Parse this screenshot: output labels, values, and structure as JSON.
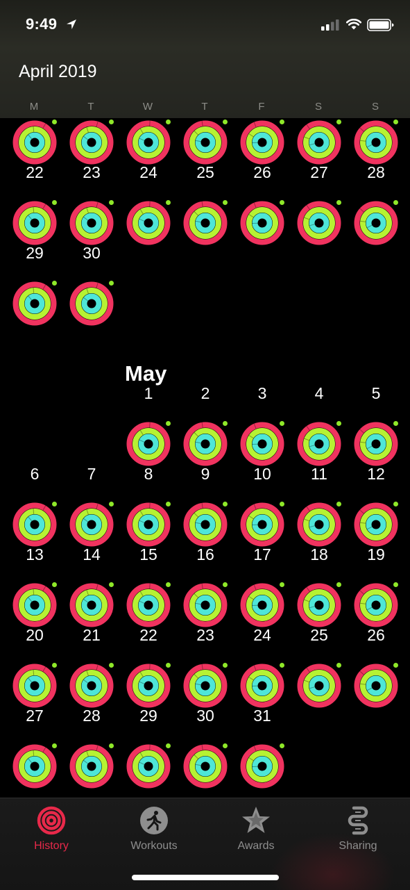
{
  "status_bar": {
    "time": "9:49",
    "icons": [
      "location-arrow-icon",
      "cellular-signal-icon",
      "wifi-icon",
      "battery-icon"
    ]
  },
  "header": {
    "month_title": "April 2019",
    "weekdays": [
      "M",
      "T",
      "W",
      "T",
      "F",
      "S",
      "S"
    ]
  },
  "calendar": {
    "april": {
      "rows": [
        {
          "days": [
            "",
            "",
            "",
            "",
            "",
            "",
            ""
          ],
          "rings": [
            true,
            true,
            true,
            true,
            true,
            true,
            true
          ]
        },
        {
          "days": [
            "22",
            "23",
            "24",
            "25",
            "26",
            "27",
            "28"
          ],
          "rings": [
            true,
            true,
            true,
            true,
            true,
            true,
            true
          ]
        },
        {
          "days": [
            "29",
            "30",
            "",
            "",
            "",
            "",
            ""
          ],
          "rings": [
            true,
            true,
            false,
            false,
            false,
            false,
            false
          ]
        }
      ]
    },
    "may": {
      "title": "May",
      "rows": [
        {
          "days": [
            "",
            "",
            "1",
            "2",
            "3",
            "4",
            "5"
          ],
          "rings": [
            false,
            false,
            true,
            true,
            true,
            true,
            true
          ]
        },
        {
          "days": [
            "6",
            "7",
            "8",
            "9",
            "10",
            "11",
            "12"
          ],
          "rings": [
            true,
            true,
            true,
            true,
            true,
            true,
            true
          ]
        },
        {
          "days": [
            "13",
            "14",
            "15",
            "16",
            "17",
            "18",
            "19"
          ],
          "rings": [
            true,
            true,
            true,
            true,
            true,
            true,
            true
          ]
        },
        {
          "days": [
            "20",
            "21",
            "22",
            "23",
            "24",
            "25",
            "26"
          ],
          "rings": [
            true,
            true,
            true,
            true,
            true,
            true,
            true
          ]
        },
        {
          "days": [
            "27",
            "28",
            "29",
            "30",
            "31",
            "",
            ""
          ],
          "rings": [
            true,
            true,
            true,
            true,
            true,
            false,
            false
          ]
        }
      ]
    },
    "ring_colors": {
      "move": "#f0335f",
      "exercise": "#b6f233",
      "stand": "#4ee6d8",
      "goal_dot": "#8fe829"
    }
  },
  "tabbar": {
    "tabs": [
      {
        "label": "History",
        "icon": "activity-rings-icon",
        "active": true
      },
      {
        "label": "Workouts",
        "icon": "running-figure-icon",
        "active": false
      },
      {
        "label": "Awards",
        "icon": "award-star-icon",
        "active": false
      },
      {
        "label": "Sharing",
        "icon": "sharing-icon",
        "active": false
      }
    ],
    "active_color": "#e8294a",
    "inactive_color": "#8e8e8e"
  }
}
